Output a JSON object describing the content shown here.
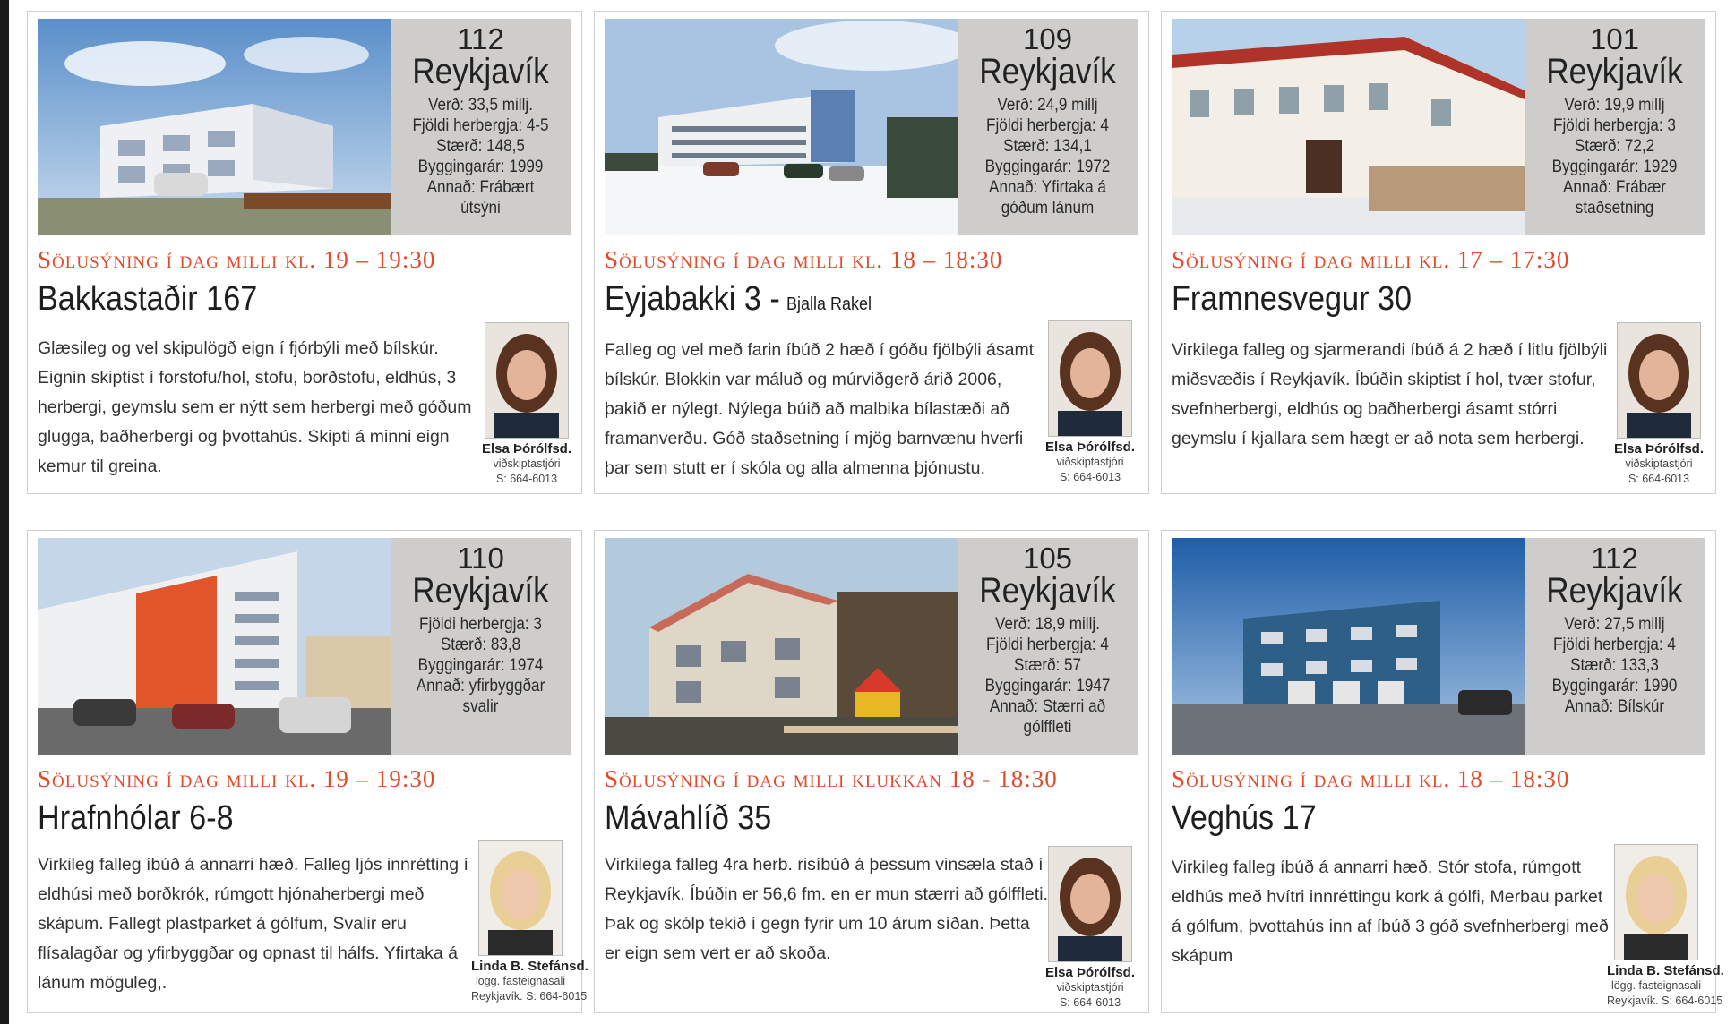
{
  "listings": [
    {
      "postcode": "112",
      "city": "Reykjavík",
      "info": [
        "Verð: 33,5 millj.",
        "Fjöldi herbergja: 4-5",
        "Stærð: 148,5",
        "Byggingarár: 1999",
        "Annað: Frábært",
        "útsýni"
      ],
      "showing": "Sölusýning í dag milli kl. 19 – 19:30",
      "street": "Bakkastaðir 167",
      "street_note": "",
      "description": "Glæsileg og vel skipulögð eign í fjórbýli  með bílskúr. Eignin skiptist í forstofu/hol, stofu, borðstofu, eldhús, 3 herbergi, geymslu sem er nýtt sem herbergi með góðum glugga, baðherbergi   og þvottahús.  Skipti á minni eign kemur til greina.",
      "agent": {
        "name": "Elsa Þórólfsd.",
        "role": "viðskiptastjóri",
        "phone": "S: 664-6013"
      }
    },
    {
      "postcode": "109",
      "city": "Reykjavík",
      "info": [
        "Verð: 24,9 millj",
        "Fjöldi herbergja: 4",
        "Stærð: 134,1",
        "Byggingarár:  1972",
        "Annað: Yfirtaka á",
        "góðum lánum"
      ],
      "showing": "Sölusýning í dag milli kl. 18 – 18:30",
      "street": "Eyjabakki 3 -",
      "street_note": "Bjalla Rakel",
      "description": "Falleg og vel með farin íbúð 2 hæð í góðu fjölbýli ásamt bílskúr. Blokkin var máluð og múrviðgerð árið 2006, þakið er nýlegt. Nýlega búið að malbika bílastæði að framanverðu. Góð staðsetning í mjög barnvænu hverfi þar sem stutt er í skóla og alla almenna þjónustu.",
      "agent": {
        "name": "Elsa Þórólfsd.",
        "role": "viðskiptastjóri",
        "phone": "S: 664-6013"
      }
    },
    {
      "postcode": "101",
      "city": "Reykjavík",
      "info": [
        "Verð: 19,9 millj",
        "Fjöldi herbergja: 3",
        "Stærð: 72,2",
        "Byggingarár:  1929",
        "Annað: Frábær",
        "staðsetning"
      ],
      "showing": "Sölusýning í dag milli kl. 17 – 17:30",
      "street": "Framnesvegur 30",
      "street_note": "",
      "description": "Virkilega falleg og sjarmerandi íbúð á 2 hæð í litlu fjölbýli miðsvæðis í Reykjavík. Íbúðin skiptist í hol, tvær stofur, svefnherbergi, eldhús og baðherbergi ásamt stórri geymslu í kjallara sem hægt er að nota sem herbergi.",
      "agent": {
        "name": "Elsa Þórólfsd.",
        "role": "viðskiptastjóri",
        "phone": "S: 664-6013"
      }
    },
    {
      "postcode": "110",
      "city": "Reykjavík",
      "info": [
        "Fjöldi herbergja: 3",
        "Stærð: 83,8",
        "Byggingarár:  1974",
        "Annað: yfirbyggðar",
        "svalir"
      ],
      "showing": "Sölusýning í dag milli kl. 19 – 19:30",
      "street": "Hrafnhólar 6-8",
      "street_note": "",
      "description": "Virkileg falleg íbúð á annarri hæð.  Falleg ljós innrétting í eldhúsi með borðkrók, rúmgott hjónaherbergi með skápum. Fallegt plastparket á gólfum,  Svalir eru flísalagðar og yfirbyggðar og opnast til hálfs. Yfirtaka á lánum möguleg,.",
      "agent": {
        "name": "Linda B. Stefánsd.",
        "role": "lögg. fasteignasali",
        "phone": "Reykjavík. S: 664-6015"
      }
    },
    {
      "postcode": "105",
      "city": "Reykjavík",
      "info": [
        "Verð: 18,9 millj.",
        "Fjöldi herbergja: 4",
        "Stærð: 57",
        "Byggingarár:  1947",
        "Annað: Stærri að",
        "gólffleti"
      ],
      "showing": "Sölusýning í dag milli klukkan 18 - 18:30",
      "street": "Mávahlíð 35",
      "street_note": "",
      "description": "Virkilega falleg 4ra herb. risíbúð á þessum vinsæla stað í Reykjavík. Íbúðin er 56,6 fm. en er mun stærri að gólffleti. Þak og skólp tekið í gegn fyrir um 10 árum síðan. Þetta er eign sem vert er að skoða.",
      "agent": {
        "name": "Elsa Þórólfsd.",
        "role": "viðskiptastjóri",
        "phone": "S: 664-6013"
      }
    },
    {
      "postcode": "112",
      "city": "Reykjavík",
      "info": [
        "Verð: 27,5 millj",
        "Fjöldi herbergja: 4",
        "Stærð: 133,3",
        "Byggingarár:  1990",
        "Annað: Bílskúr"
      ],
      "showing": "Sölusýning í dag milli kl. 18 – 18:30",
      "street": "Veghús 17",
      "street_note": "",
      "description": "Virkileg falleg íbúð á annarri hæð. Stór stofa, rúmgott eldhús með hvítri innréttingu kork á gólfi, Merbau parket á gólfum, þvottahús inn af íbúð 3 góð svefnherbergi með skápum",
      "agent": {
        "name": "Linda B. Stefánsd.",
        "role": "lögg. fasteignasali",
        "phone": "Reykjavík. S: 664-6015"
      }
    }
  ]
}
